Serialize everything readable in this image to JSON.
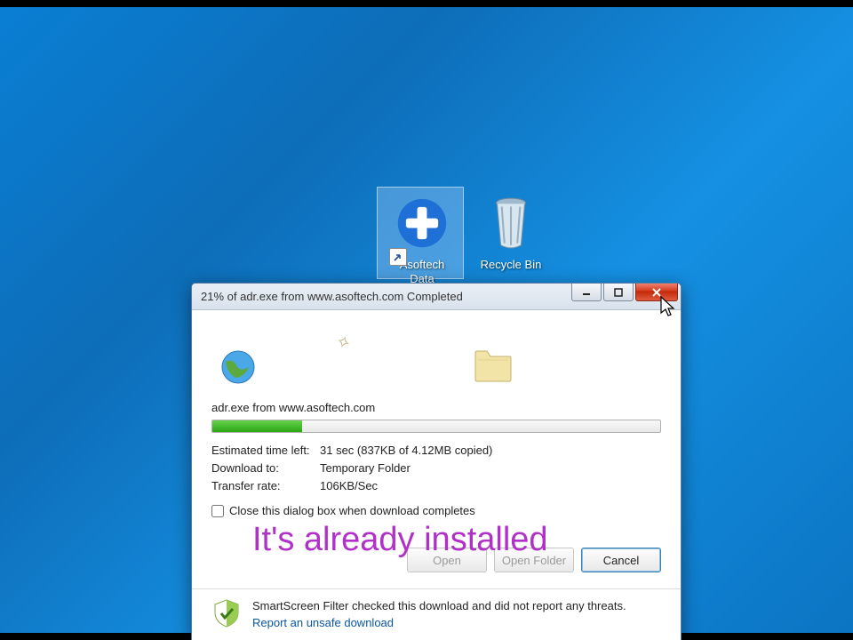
{
  "desktop": {
    "icons": {
      "asoftech": {
        "label_line1": "Asoftech",
        "label_line2": "Data"
      },
      "recycle": {
        "label": "Recycle Bin"
      }
    }
  },
  "dialog": {
    "title": "21% of adr.exe from www.asoftech.com Completed",
    "file_label": "adr.exe from www.asoftech.com",
    "progress_percent": 20,
    "stats": {
      "time_left_label": "Estimated time left:",
      "time_left_value": "31 sec (837KB of 4.12MB copied)",
      "download_to_label": "Download to:",
      "download_to_value": "Temporary Folder",
      "rate_label": "Transfer rate:",
      "rate_value": "106KB/Sec"
    },
    "close_checkbox_label": "Close this dialog box when download completes",
    "buttons": {
      "open": "Open",
      "open_folder": "Open Folder",
      "cancel": "Cancel"
    },
    "smartscreen": {
      "text": "SmartScreen Filter checked this download and did not report any threats.",
      "link": "Report an unsafe download"
    }
  },
  "overlay_caption": "It's already installed"
}
